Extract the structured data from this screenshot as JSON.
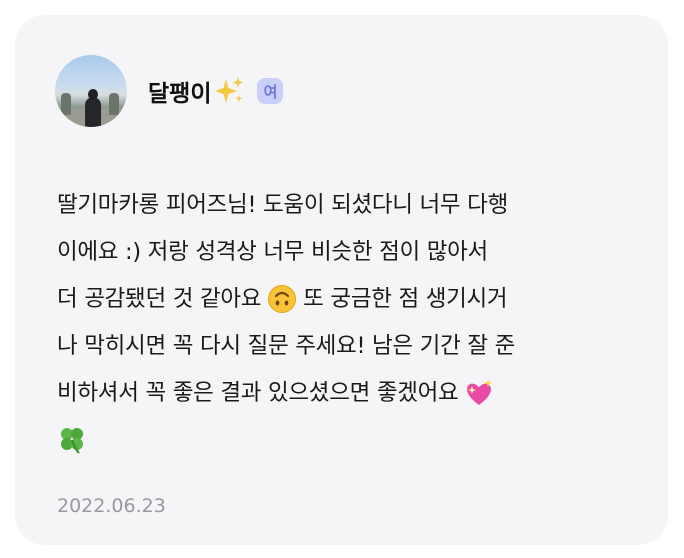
{
  "author": {
    "name": "달팽이",
    "badge": "여",
    "avatar_icon": "profile-photo"
  },
  "comment": {
    "lines": [
      "딸기마카롱 피어즈님! 도움이 되셨다니 너무 다행",
      "이에요 :) 저랑 성격상 너무 비슷한 점이 많아서",
      "더 공감됐던 것 같아요",
      "또 궁금한 점 생기시거",
      "나 막히시면 꼭 다시 질문 주세요! 남은 기간 잘 준",
      "비하셔서 꼭 좋은 결과 있으셨으면 좋겠어요"
    ],
    "emojis": [
      "sparkles-emoji",
      "upside-down-face-emoji",
      "sparkling-heart-emoji",
      "four-leaf-clover-emoji"
    ]
  },
  "date": "2022.06.23",
  "colors": {
    "card_bg": "#f5f5f7",
    "badge_bg": "#c9cff6",
    "badge_text": "#6e78d6",
    "date_text": "#9a9a9e"
  }
}
